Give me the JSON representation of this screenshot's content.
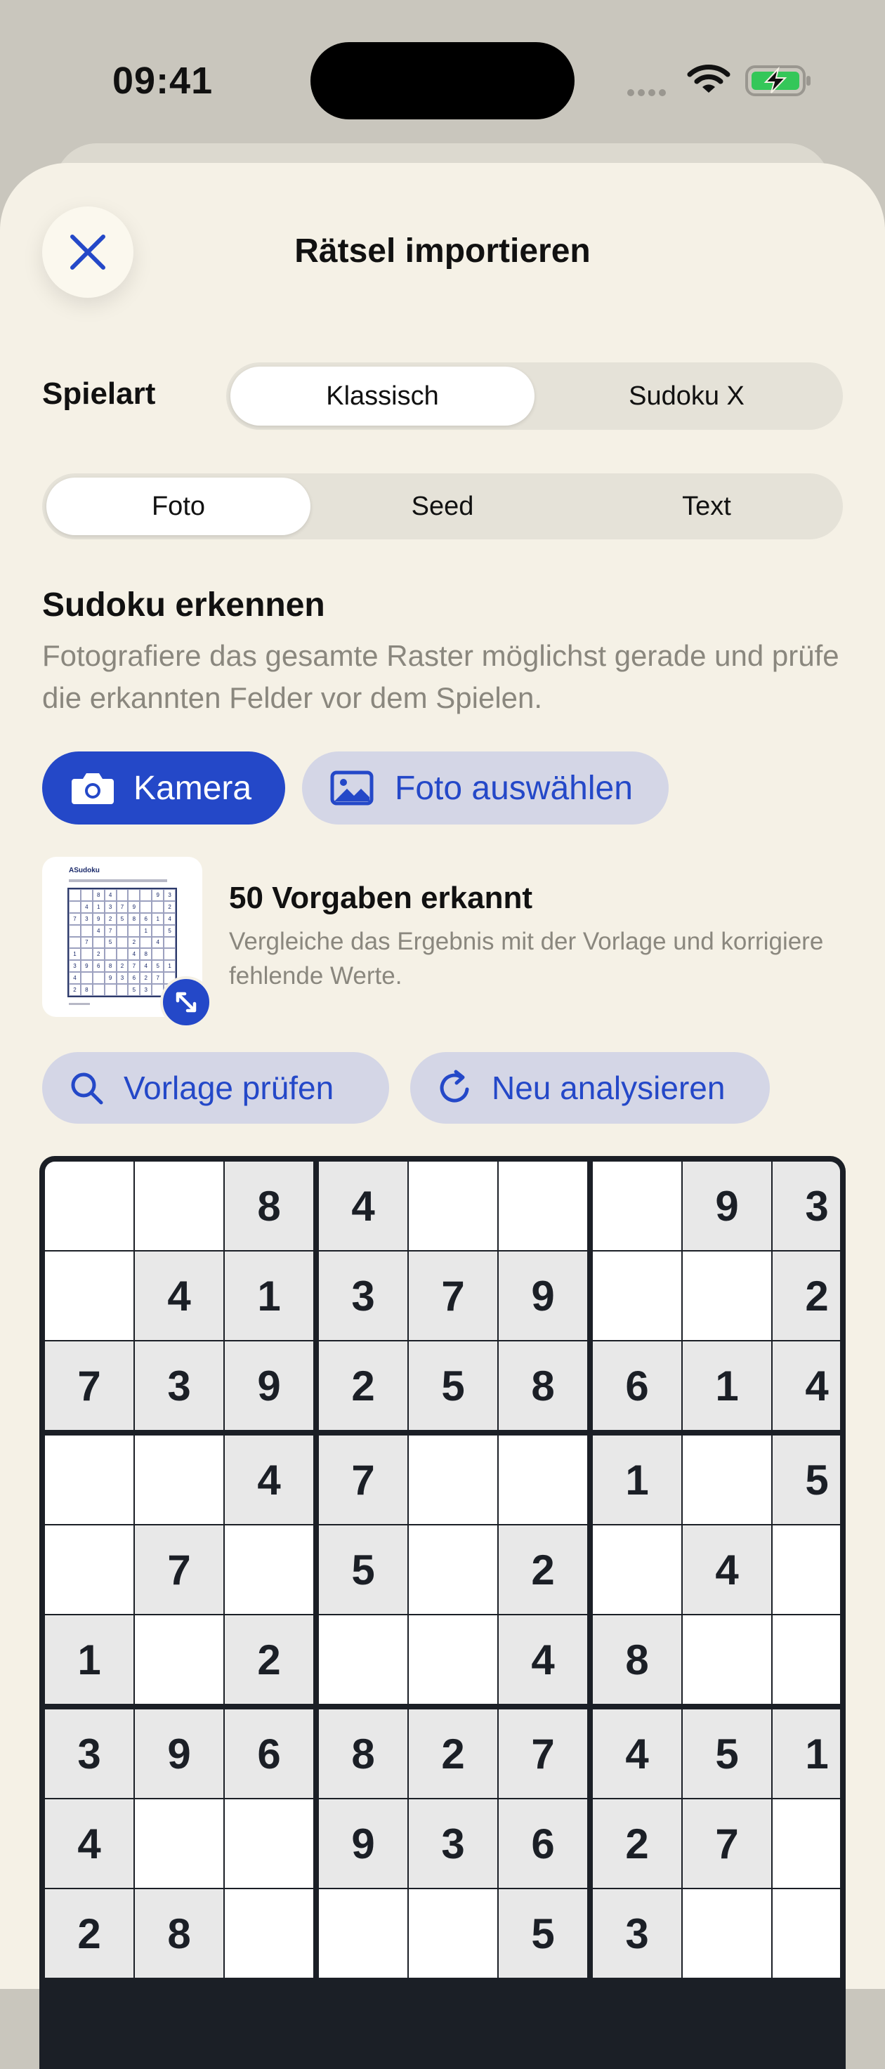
{
  "status_bar": {
    "time": "09:41"
  },
  "header": {
    "title": "Rätsel importieren",
    "close_icon": "close-icon"
  },
  "game_type": {
    "label": "Spielart",
    "options": [
      "Klassisch",
      "Sudoku X"
    ],
    "selected": "Klassisch"
  },
  "import_mode": {
    "options": [
      "Foto",
      "Seed",
      "Text"
    ],
    "selected": "Foto"
  },
  "recognize": {
    "title": "Sudoku erkennen",
    "description": "Fotografiere das gesamte Raster möglichst gerade und prüfe die erkannten Felder vor dem Spielen.",
    "camera_label": "Kamera",
    "photo_label": "Foto auswählen"
  },
  "result": {
    "thumbnail_title": "ASudoku",
    "title": "50 Vorgaben erkannt",
    "description": "Vergleiche das Ergebnis mit der Vorlage und korrigiere fehlende Werte."
  },
  "actions": {
    "check_label": "Vorlage prüfen",
    "reanalyze_label": "Neu analysieren"
  },
  "colors": {
    "accent": "#2448c8",
    "sheet_background": "#f5f1e6",
    "given_cell": "#e8e8e8",
    "empty_cell": "#ffffff"
  },
  "grid": [
    [
      "",
      "",
      "8",
      "4",
      "",
      "",
      "",
      "9",
      "3"
    ],
    [
      "",
      "4",
      "1",
      "3",
      "7",
      "9",
      "",
      "",
      "2"
    ],
    [
      "7",
      "3",
      "9",
      "2",
      "5",
      "8",
      "6",
      "1",
      "4"
    ],
    [
      "",
      "",
      "4",
      "7",
      "",
      "",
      "1",
      "",
      "5"
    ],
    [
      "",
      "7",
      "",
      "5",
      "",
      "2",
      "",
      "4",
      ""
    ],
    [
      "1",
      "",
      "2",
      "",
      "",
      "4",
      "8",
      "",
      ""
    ],
    [
      "3",
      "9",
      "6",
      "8",
      "2",
      "7",
      "4",
      "5",
      "1"
    ],
    [
      "4",
      "",
      "",
      "9",
      "3",
      "6",
      "2",
      "7",
      ""
    ],
    [
      "2",
      "8",
      "",
      "",
      "",
      "5",
      "3",
      "",
      ""
    ]
  ]
}
